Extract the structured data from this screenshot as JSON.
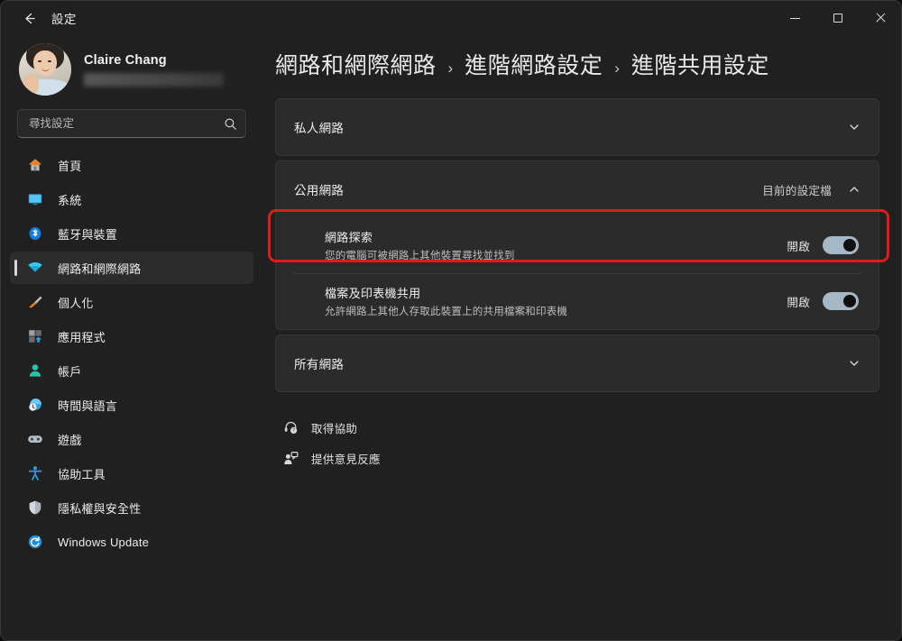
{
  "window": {
    "title": "設定",
    "back_label": "back-arrow",
    "controls": {
      "minimize": "最小化",
      "maximize": "最大化",
      "close": "關閉"
    }
  },
  "account": {
    "name": "Claire Chang",
    "email_redacted": ""
  },
  "search": {
    "placeholder": "尋找設定",
    "value": ""
  },
  "sidebar": {
    "items": [
      {
        "label": "首頁",
        "icon": "home-icon",
        "selected": false
      },
      {
        "label": "系統",
        "icon": "system-icon",
        "selected": false
      },
      {
        "label": "藍牙與裝置",
        "icon": "bluetooth-icon",
        "selected": false
      },
      {
        "label": "網路和網際網路",
        "icon": "wifi-icon",
        "selected": true
      },
      {
        "label": "個人化",
        "icon": "personalization-icon",
        "selected": false
      },
      {
        "label": "應用程式",
        "icon": "apps-icon",
        "selected": false
      },
      {
        "label": "帳戶",
        "icon": "accounts-icon",
        "selected": false
      },
      {
        "label": "時間與語言",
        "icon": "time-language-icon",
        "selected": false
      },
      {
        "label": "遊戲",
        "icon": "gaming-icon",
        "selected": false
      },
      {
        "label": "協助工具",
        "icon": "accessibility-icon",
        "selected": false
      },
      {
        "label": "隱私權與安全性",
        "icon": "privacy-security-icon",
        "selected": false
      },
      {
        "label": "Windows Update",
        "icon": "windows-update-icon",
        "selected": false
      }
    ]
  },
  "breadcrumb": {
    "items": [
      {
        "label": "網路和網際網路"
      },
      {
        "label": "進階網路設定"
      },
      {
        "label": "進階共用設定"
      }
    ],
    "separator": "›"
  },
  "main": {
    "sections": [
      {
        "title": "私人網路",
        "meta": "",
        "expanded": false,
        "chevron": "chevron-down-icon"
      },
      {
        "title": "公用網路",
        "meta": "目前的設定檔",
        "expanded": true,
        "chevron": "chevron-up-icon",
        "rows": [
          {
            "title": "網路探索",
            "desc": "您的電腦可被網路上其他裝置尋找並找到",
            "toggle_label": "開啟",
            "toggle_on": true,
            "highlighted": true
          },
          {
            "title": "檔案及印表機共用",
            "desc": "允許網路上其他人存取此裝置上的共用檔案和印表機",
            "toggle_label": "開啟",
            "toggle_on": true,
            "highlighted": false
          }
        ]
      },
      {
        "title": "所有網路",
        "meta": "",
        "expanded": false,
        "chevron": "chevron-down-icon"
      }
    ]
  },
  "footer": {
    "links": [
      {
        "label": "取得協助",
        "icon": "help-icon"
      },
      {
        "label": "提供意見反應",
        "icon": "feedback-icon"
      }
    ]
  },
  "colors": {
    "page_background": "#202020",
    "card_background": "#2b2b2b",
    "toggle_on": "#a6b8c6",
    "highlight_border": "#e11b1b",
    "accent_selected": "#d6d6d6",
    "text_primary": "#ededed",
    "text_secondary": "#bdbdbd"
  }
}
